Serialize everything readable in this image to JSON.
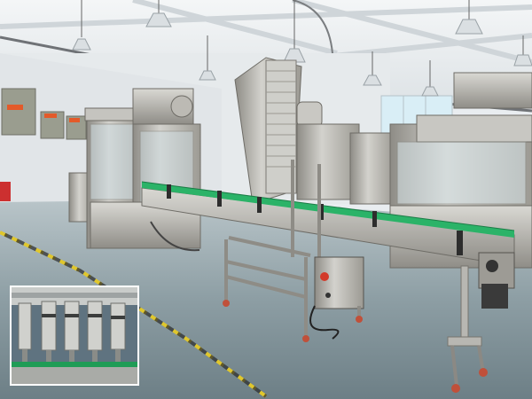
{
  "scene": {
    "description_label": "",
    "wall_panel_labels": [
      "",
      "",
      ""
    ]
  },
  "colors": {
    "floor": "#7d8e95",
    "floor_light": "#a9b8bd",
    "wall": "#e7ebee",
    "ceiling": "#f2f4f5",
    "steel": "#b7b6b1",
    "steel_dark": "#7c7a74",
    "conveyor_green": "#2bb368",
    "hazard_yellow": "#e0c72c",
    "red_accent": "#d23a2a"
  }
}
